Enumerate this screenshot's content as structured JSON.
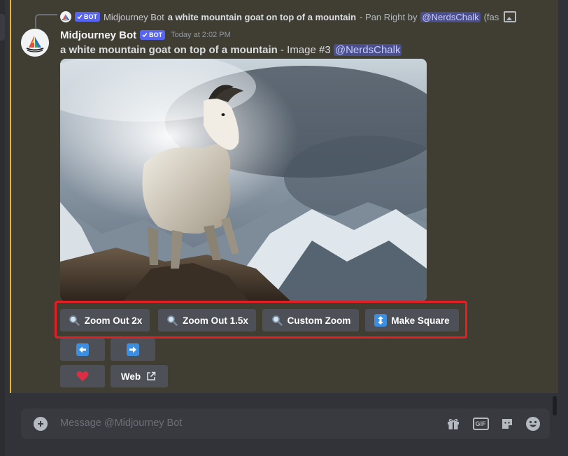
{
  "reply": {
    "bot_tag": "BOT",
    "author": "Midjourney Bot",
    "content": "a white mountain goat on top of a mountain",
    "suffix": "- Pan Right by",
    "mention": "@NerdsChalk",
    "trail": "(fas"
  },
  "message": {
    "username": "Midjourney Bot",
    "bot_tag": "BOT",
    "timestamp": "Today at 2:02 PM",
    "prompt": "a white mountain goat on top of a mountain",
    "suffix": "- Image #3",
    "mention": "@NerdsChalk"
  },
  "buttons": {
    "zoom_out_2x": "Zoom Out 2x",
    "zoom_out_15x": "Zoom Out 1.5x",
    "custom_zoom": "Custom Zoom",
    "make_square": "Make Square",
    "web": "Web"
  },
  "composer": {
    "placeholder": "Message @Midjourney Bot",
    "gif_label": "GIF"
  },
  "colors": {
    "background": "#313338",
    "highlighted_message": "#403d33",
    "highlight_bar": "#f0b232",
    "button": "#4e5058",
    "bot_tag": "#5865f2",
    "annotation_box": "#e41e24",
    "heart": "#dd2e44",
    "arrow_tile": "#3b8ee0"
  },
  "icons": [
    "check-icon",
    "image-icon",
    "magnifier-icon",
    "up-down-arrow-icon",
    "left-arrow-icon",
    "right-arrow-icon",
    "heart-icon",
    "external-link-icon",
    "plus-icon",
    "gift-icon",
    "gif-icon",
    "sticker-icon",
    "emoji-icon"
  ]
}
